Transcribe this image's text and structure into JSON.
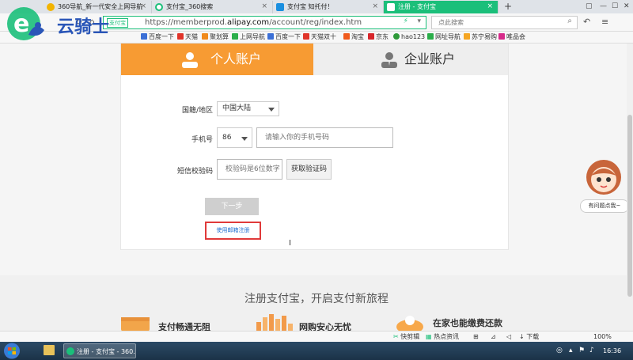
{
  "browser": {
    "tabs": [
      {
        "label": "360导航_新一代安全上网导航"
      },
      {
        "label": "支付宝_360搜索"
      },
      {
        "label": "支付宝 知托付！"
      },
      {
        "label": "注册 - 支付宝",
        "active": true
      }
    ],
    "new_tab": "+",
    "cert_label": "支付宝",
    "url_prefix": "https://memberprod.",
    "url_domain": "alipay.com",
    "url_path": "/account/reg/index.htm",
    "search_placeholder": "点此搜索",
    "accent_color": "#1bbf7a"
  },
  "bookmarks": [
    {
      "label": "百度一下",
      "color": "#3b6fd6"
    },
    {
      "label": "天猫",
      "color": "#e0342a"
    },
    {
      "label": "聚划算",
      "color": "#f08a1c"
    },
    {
      "label": "上网导航",
      "color": "#2bae4a"
    },
    {
      "label": "百度一下",
      "color": "#3b6fd6"
    },
    {
      "label": "天猫双十",
      "color": "#e0342a"
    },
    {
      "label": "淘宝",
      "color": "#f05a1c"
    },
    {
      "label": "京东",
      "color": "#d7262b"
    },
    {
      "label": "hao123",
      "color": "#2f9a3a"
    },
    {
      "label": "网址导航",
      "color": "#2bae4a"
    },
    {
      "label": "苏宁易购",
      "color": "#f5a623"
    },
    {
      "label": "唯品会",
      "color": "#d62b8a"
    }
  ],
  "watermark": {
    "text": "云骑士"
  },
  "register": {
    "tab_personal": "个人账户",
    "tab_business": "企业账户",
    "country_label": "国籍/地区",
    "country_value": "中国大陆",
    "phone_label": "手机号",
    "phone_code": "86",
    "phone_placeholder": "请输入你的手机号码",
    "sms_label": "短信校验码",
    "sms_placeholder": "校验码是6位数字",
    "get_code_button": "获取验证码",
    "next_button": "下一步",
    "email_link": "使用邮箱注册",
    "tab_color": "#f79b33"
  },
  "helper": {
    "label": "有问题点我~"
  },
  "promo": {
    "slogan": "注册支付宝，开启支付新旅程",
    "features": [
      "支付畅通无阻",
      "网购安心无忧",
      "在家也能缴费还款"
    ]
  },
  "statusbar": {
    "items": [
      "快剪辑",
      "热点资讯",
      "下载",
      "100%"
    ]
  },
  "taskbar": {
    "item_label": "注册 - 支付宝 - 360...",
    "time": "16:36"
  }
}
